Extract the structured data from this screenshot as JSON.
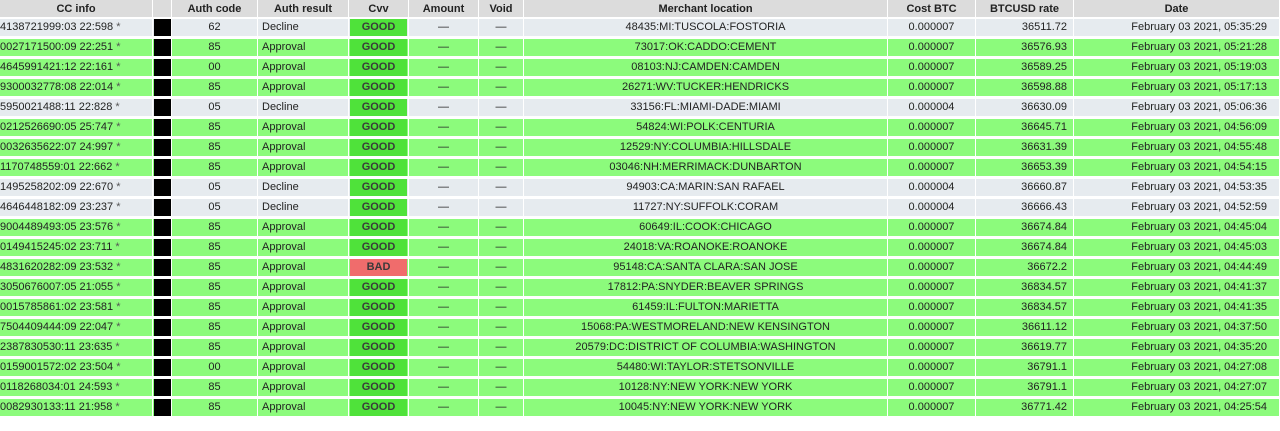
{
  "columns": [
    "CC info",
    "",
    "Auth code",
    "Auth result",
    "Cvv",
    "Amount",
    "Void",
    "Merchant location",
    "Cost BTC",
    "BTCUSD rate",
    "Date"
  ],
  "colors": {
    "approval_row": "#8cfb7c",
    "decline_row": "#e6ebef",
    "good_badge": "#4fe23a",
    "bad_badge": "#f06c6c"
  },
  "rows": [
    {
      "cc": "4138721999:03 22:598",
      "star": "*",
      "auth_code": "62",
      "auth_result": "Decline",
      "cvv": "GOOD",
      "amount": "—",
      "void": "—",
      "location": "48435:MI:TUSCOLA:FOSTORIA",
      "cost_btc": "0.000007",
      "rate": "36511.72",
      "date": "February 03 2021, 05:35:29"
    },
    {
      "cc": "0027171500:09 22:251",
      "star": "*",
      "auth_code": "85",
      "auth_result": "Approval",
      "cvv": "GOOD",
      "amount": "—",
      "void": "—",
      "location": "73017:OK:CADDO:CEMENT",
      "cost_btc": "0.000007",
      "rate": "36576.93",
      "date": "February 03 2021, 05:21:28"
    },
    {
      "cc": "4645991421:12 22:161",
      "star": "*",
      "auth_code": "00",
      "auth_result": "Approval",
      "cvv": "GOOD",
      "amount": "—",
      "void": "—",
      "location": "08103:NJ:CAMDEN:CAMDEN",
      "cost_btc": "0.000007",
      "rate": "36589.25",
      "date": "February 03 2021, 05:19:03"
    },
    {
      "cc": "9300032778:08 22:014",
      "star": "*",
      "auth_code": "85",
      "auth_result": "Approval",
      "cvv": "GOOD",
      "amount": "—",
      "void": "—",
      "location": "26271:WV:TUCKER:HENDRICKS",
      "cost_btc": "0.000007",
      "rate": "36598.88",
      "date": "February 03 2021, 05:17:13"
    },
    {
      "cc": "5950021488:11 22:828",
      "star": "*",
      "auth_code": "05",
      "auth_result": "Decline",
      "cvv": "GOOD",
      "amount": "—",
      "void": "—",
      "location": "33156:FL:MIAMI-DADE:MIAMI",
      "cost_btc": "0.000004",
      "rate": "36630.09",
      "date": "February 03 2021, 05:06:36"
    },
    {
      "cc": "0212526690:05 25:747",
      "star": "*",
      "auth_code": "85",
      "auth_result": "Approval",
      "cvv": "GOOD",
      "amount": "—",
      "void": "—",
      "location": "54824:WI:POLK:CENTURIA",
      "cost_btc": "0.000007",
      "rate": "36645.71",
      "date": "February 03 2021, 04:56:09"
    },
    {
      "cc": "0032635622:07 24:997",
      "star": "*",
      "auth_code": "85",
      "auth_result": "Approval",
      "cvv": "GOOD",
      "amount": "—",
      "void": "—",
      "location": "12529:NY:COLUMBIA:HILLSDALE",
      "cost_btc": "0.000007",
      "rate": "36631.39",
      "date": "February 03 2021, 04:55:48"
    },
    {
      "cc": "1170748559:01 22:662",
      "star": "*",
      "auth_code": "85",
      "auth_result": "Approval",
      "cvv": "GOOD",
      "amount": "—",
      "void": "—",
      "location": "03046:NH:MERRIMACK:DUNBARTON",
      "cost_btc": "0.000007",
      "rate": "36653.39",
      "date": "February 03 2021, 04:54:15"
    },
    {
      "cc": "1495258202:09 22:670",
      "star": "*",
      "auth_code": "05",
      "auth_result": "Decline",
      "cvv": "GOOD",
      "amount": "—",
      "void": "—",
      "location": "94903:CA:MARIN:SAN RAFAEL",
      "cost_btc": "0.000004",
      "rate": "36660.87",
      "date": "February 03 2021, 04:53:35"
    },
    {
      "cc": "4646448182:09 23:237",
      "star": "*",
      "auth_code": "05",
      "auth_result": "Decline",
      "cvv": "GOOD",
      "amount": "—",
      "void": "—",
      "location": "11727:NY:SUFFOLK:CORAM",
      "cost_btc": "0.000004",
      "rate": "36666.43",
      "date": "February 03 2021, 04:52:59"
    },
    {
      "cc": "9004489493:05 23:576",
      "star": "*",
      "auth_code": "85",
      "auth_result": "Approval",
      "cvv": "GOOD",
      "amount": "—",
      "void": "—",
      "location": "60649:IL:COOK:CHICAGO",
      "cost_btc": "0.000007",
      "rate": "36674.84",
      "date": "February 03 2021, 04:45:04"
    },
    {
      "cc": "0149415245:02 23:711",
      "star": "*",
      "auth_code": "85",
      "auth_result": "Approval",
      "cvv": "GOOD",
      "amount": "—",
      "void": "—",
      "location": "24018:VA:ROANOKE:ROANOKE",
      "cost_btc": "0.000007",
      "rate": "36674.84",
      "date": "February 03 2021, 04:45:03"
    },
    {
      "cc": "4831620282:09 23:532",
      "star": "*",
      "auth_code": "85",
      "auth_result": "Approval",
      "cvv": "BAD",
      "amount": "—",
      "void": "—",
      "location": "95148:CA:SANTA CLARA:SAN JOSE",
      "cost_btc": "0.000007",
      "rate": "36672.2",
      "date": "February 03 2021, 04:44:49"
    },
    {
      "cc": "3050676007:05 21:055",
      "star": "*",
      "auth_code": "85",
      "auth_result": "Approval",
      "cvv": "GOOD",
      "amount": "—",
      "void": "—",
      "location": "17812:PA:SNYDER:BEAVER SPRINGS",
      "cost_btc": "0.000007",
      "rate": "36834.57",
      "date": "February 03 2021, 04:41:37"
    },
    {
      "cc": "0015785861:02 23:581",
      "star": "*",
      "auth_code": "85",
      "auth_result": "Approval",
      "cvv": "GOOD",
      "amount": "—",
      "void": "—",
      "location": "61459:IL:FULTON:MARIETTA",
      "cost_btc": "0.000007",
      "rate": "36834.57",
      "date": "February 03 2021, 04:41:35"
    },
    {
      "cc": "7504409444:09 22:047",
      "star": "*",
      "auth_code": "85",
      "auth_result": "Approval",
      "cvv": "GOOD",
      "amount": "—",
      "void": "—",
      "location": "15068:PA:WESTMORELAND:NEW KENSINGTON",
      "cost_btc": "0.000007",
      "rate": "36611.12",
      "date": "February 03 2021, 04:37:50"
    },
    {
      "cc": "2387830530:11 23:635",
      "star": "*",
      "auth_code": "85",
      "auth_result": "Approval",
      "cvv": "GOOD",
      "amount": "—",
      "void": "—",
      "location": "20579:DC:DISTRICT OF COLUMBIA:WASHINGTON",
      "cost_btc": "0.000007",
      "rate": "36619.77",
      "date": "February 03 2021, 04:35:20"
    },
    {
      "cc": "0159001572:02 23:504",
      "star": "*",
      "auth_code": "00",
      "auth_result": "Approval",
      "cvv": "GOOD",
      "amount": "—",
      "void": "—",
      "location": "54480:WI:TAYLOR:STETSONVILLE",
      "cost_btc": "0.000007",
      "rate": "36791.1",
      "date": "February 03 2021, 04:27:08"
    },
    {
      "cc": "0118268034:01 24:593",
      "star": "*",
      "auth_code": "85",
      "auth_result": "Approval",
      "cvv": "GOOD",
      "amount": "—",
      "void": "—",
      "location": "10128:NY:NEW YORK:NEW YORK",
      "cost_btc": "0.000007",
      "rate": "36791.1",
      "date": "February 03 2021, 04:27:07"
    },
    {
      "cc": "0082930133:11 21:958",
      "star": "*",
      "auth_code": "85",
      "auth_result": "Approval",
      "cvv": "GOOD",
      "amount": "—",
      "void": "—",
      "location": "10045:NY:NEW YORK:NEW YORK",
      "cost_btc": "0.000007",
      "rate": "36771.42",
      "date": "February 03 2021, 04:25:54"
    }
  ]
}
